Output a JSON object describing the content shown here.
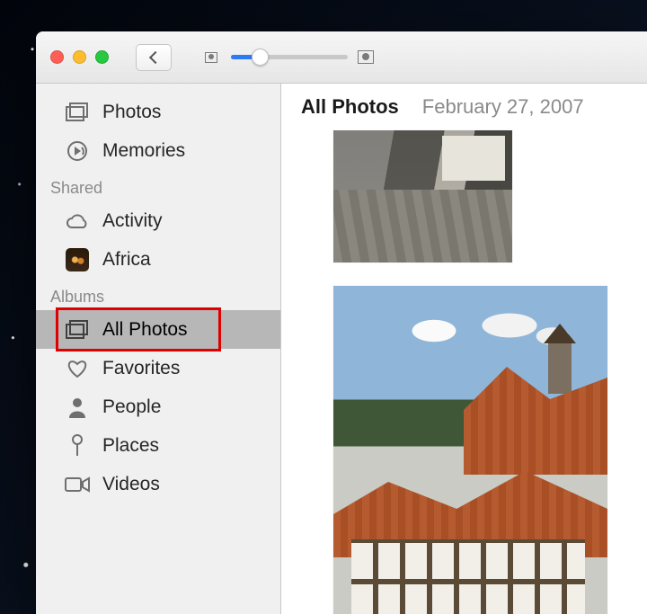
{
  "window": {
    "traffic": {
      "close": "#ff5f57",
      "min": "#febc2e",
      "zoom": "#28c840"
    }
  },
  "toolbar": {
    "zoom_slider_pct": 22
  },
  "sidebar": {
    "library": [
      {
        "icon": "photos-icon",
        "label": "Photos"
      },
      {
        "icon": "memories-icon",
        "label": "Memories"
      }
    ],
    "shared_header": "Shared",
    "shared": [
      {
        "icon": "cloud-icon",
        "label": "Activity"
      },
      {
        "icon": "africa-thumb",
        "label": "Africa"
      }
    ],
    "albums_header": "Albums",
    "albums": [
      {
        "icon": "photos-icon",
        "label": "All Photos",
        "selected": true,
        "highlight": true
      },
      {
        "icon": "heart-icon",
        "label": "Favorites"
      },
      {
        "icon": "person-icon",
        "label": "People"
      },
      {
        "icon": "pin-icon",
        "label": "Places"
      },
      {
        "icon": "video-icon",
        "label": "Videos"
      }
    ]
  },
  "content": {
    "title": "All Photos",
    "date_range": "February 27, 2007"
  }
}
